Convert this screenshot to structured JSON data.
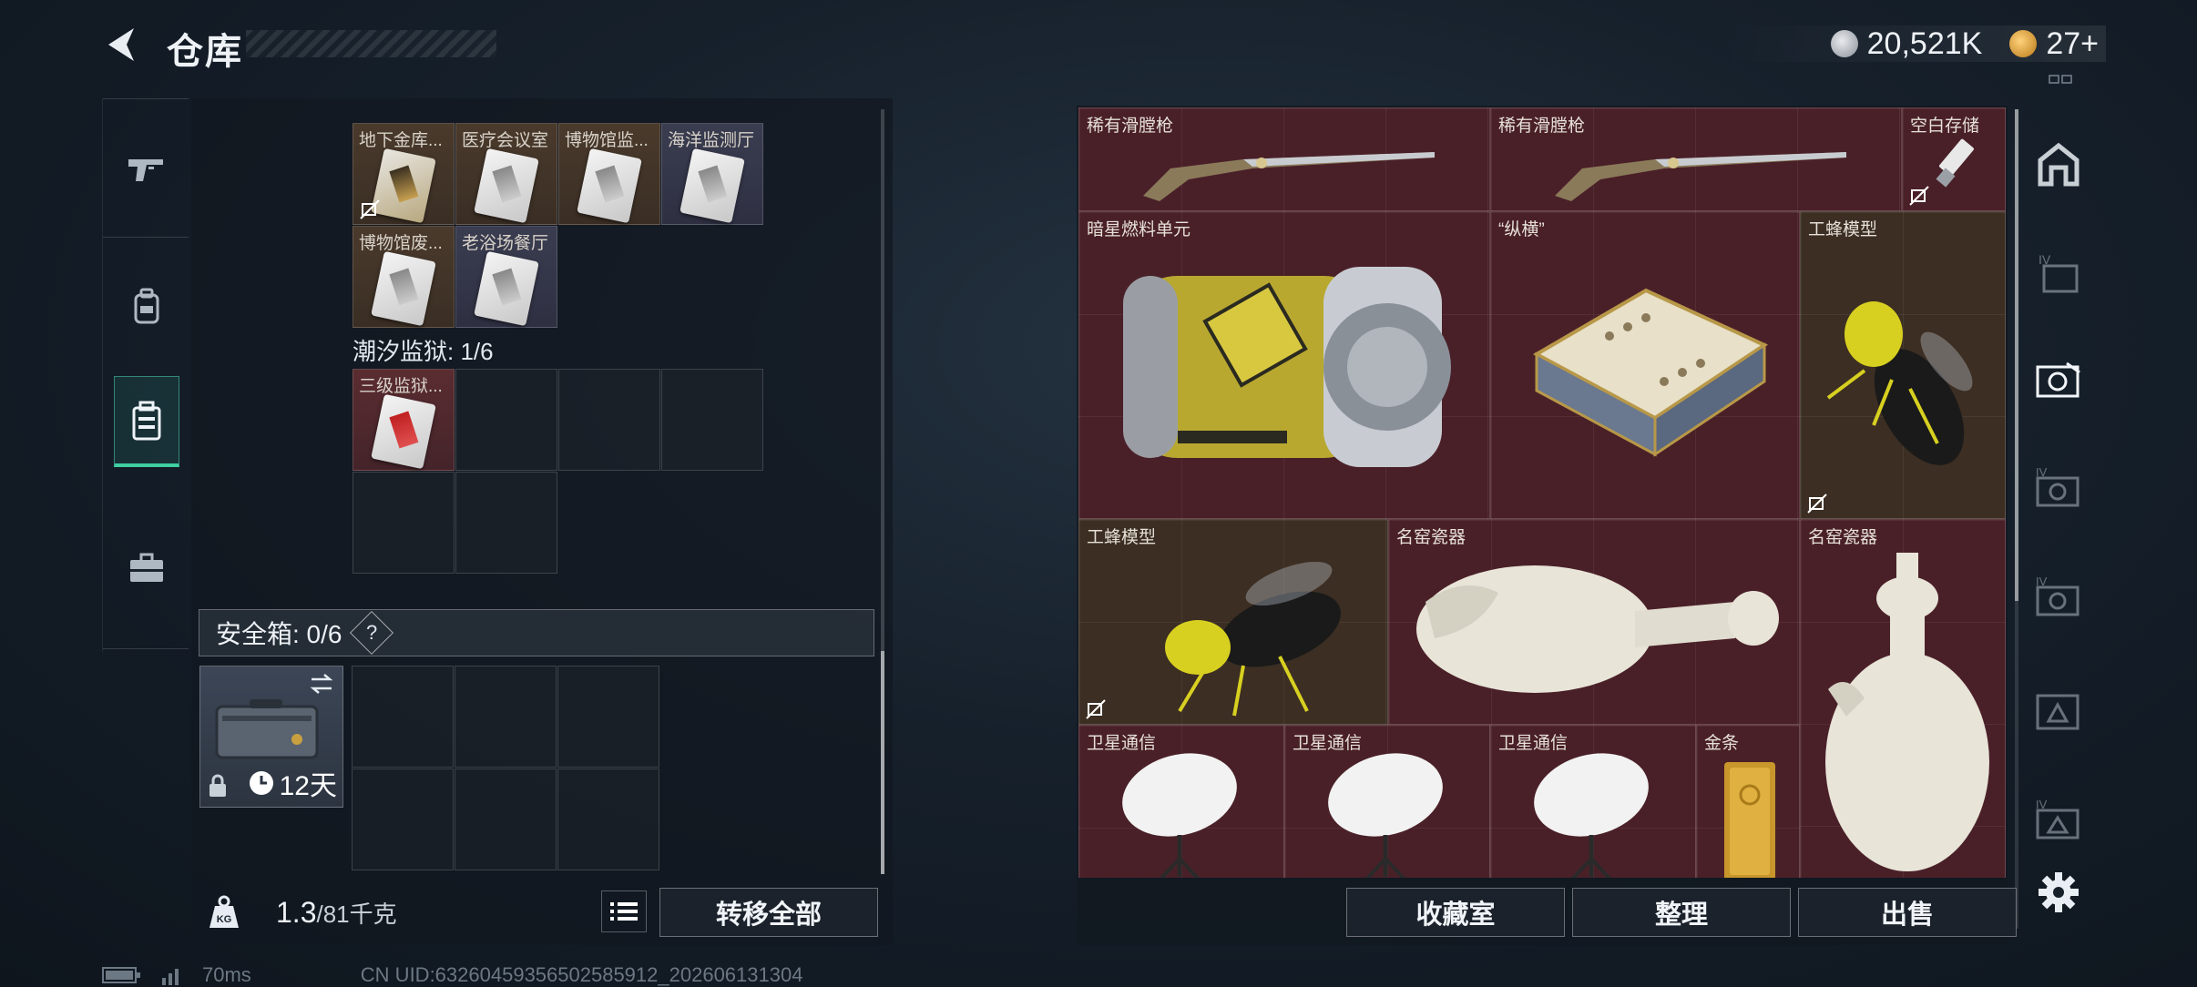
{
  "header": {
    "title": "仓库",
    "currency": [
      {
        "icon": "silver-coin-icon",
        "value": "20,521K",
        "color": "#b8bcc2"
      },
      {
        "icon": "gold-coin-icon",
        "value": "27+",
        "color": "#e0a630"
      }
    ]
  },
  "left_tabs": [
    {
      "icon": "pistol-icon",
      "active": false
    },
    {
      "icon": "backpack-icon",
      "active": false
    },
    {
      "icon": "storage-case-icon",
      "active": true
    },
    {
      "icon": "briefcase-icon",
      "active": false
    }
  ],
  "keycards": {
    "group1_cards": [
      {
        "label": "地下金库...",
        "style": "gold"
      },
      {
        "label": "医疗会议室",
        "style": "silver"
      },
      {
        "label": "博物馆监...",
        "style": "silver"
      },
      {
        "label": "海洋监测厅",
        "style": "silver"
      },
      {
        "label": "博物馆废...",
        "style": "silver"
      },
      {
        "label": "老浴场餐厅",
        "style": "silver"
      }
    ],
    "group2_title": "潮汐监狱: 1/6",
    "group2_cards": [
      {
        "label": "三级监狱...",
        "style": "red"
      }
    ]
  },
  "safebox": {
    "label": "安全箱:  0/6",
    "help": "?",
    "days": "12天"
  },
  "footer_left": {
    "weight_current": "1.3",
    "weight_max": "/81千克",
    "transfer_all": "转移全部"
  },
  "status": {
    "ping": "70ms",
    "uid": "CN UID:6326045935650258591​2_202606131304"
  },
  "items": [
    {
      "label": "稀有滑膛枪",
      "art": "musket"
    },
    {
      "label": "稀有滑膛枪",
      "art": "musket"
    },
    {
      "label": "空白存储",
      "art": "usb"
    },
    {
      "label": "暗星燃料单元",
      "art": "fuel-cell"
    },
    {
      "label": "“纵横”",
      "art": "chess-board"
    },
    {
      "label": "工蜂模型",
      "art": "wasp"
    },
    {
      "label": "工蜂模型",
      "art": "wasp"
    },
    {
      "label": "名窑瓷器",
      "art": "vase-lying"
    },
    {
      "label": "名窑瓷器",
      "art": "vase-standing"
    },
    {
      "label": "卫星通信",
      "art": "satellite-dish"
    },
    {
      "label": "卫星通信",
      "art": "satellite-dish"
    },
    {
      "label": "卫星通信",
      "art": "satellite-dish"
    },
    {
      "label": "金条",
      "art": "gold-bar"
    }
  ],
  "footer_right": {
    "collection": "收藏室",
    "sort": "整理",
    "sell": "出售"
  },
  "right_tabs": [
    {
      "icon": "home-icon",
      "active": false
    },
    {
      "icon": "warehouse-iv-icon",
      "active": false
    },
    {
      "icon": "camera-warehouse-icon",
      "active": true
    },
    {
      "icon": "camera-warehouse-iv-icon",
      "active": false
    },
    {
      "icon": "camera-warehouse-iv-icon",
      "active": false
    },
    {
      "icon": "triangle-warehouse-icon",
      "active": false
    },
    {
      "icon": "triangle-warehouse-iv-icon",
      "active": false
    }
  ]
}
